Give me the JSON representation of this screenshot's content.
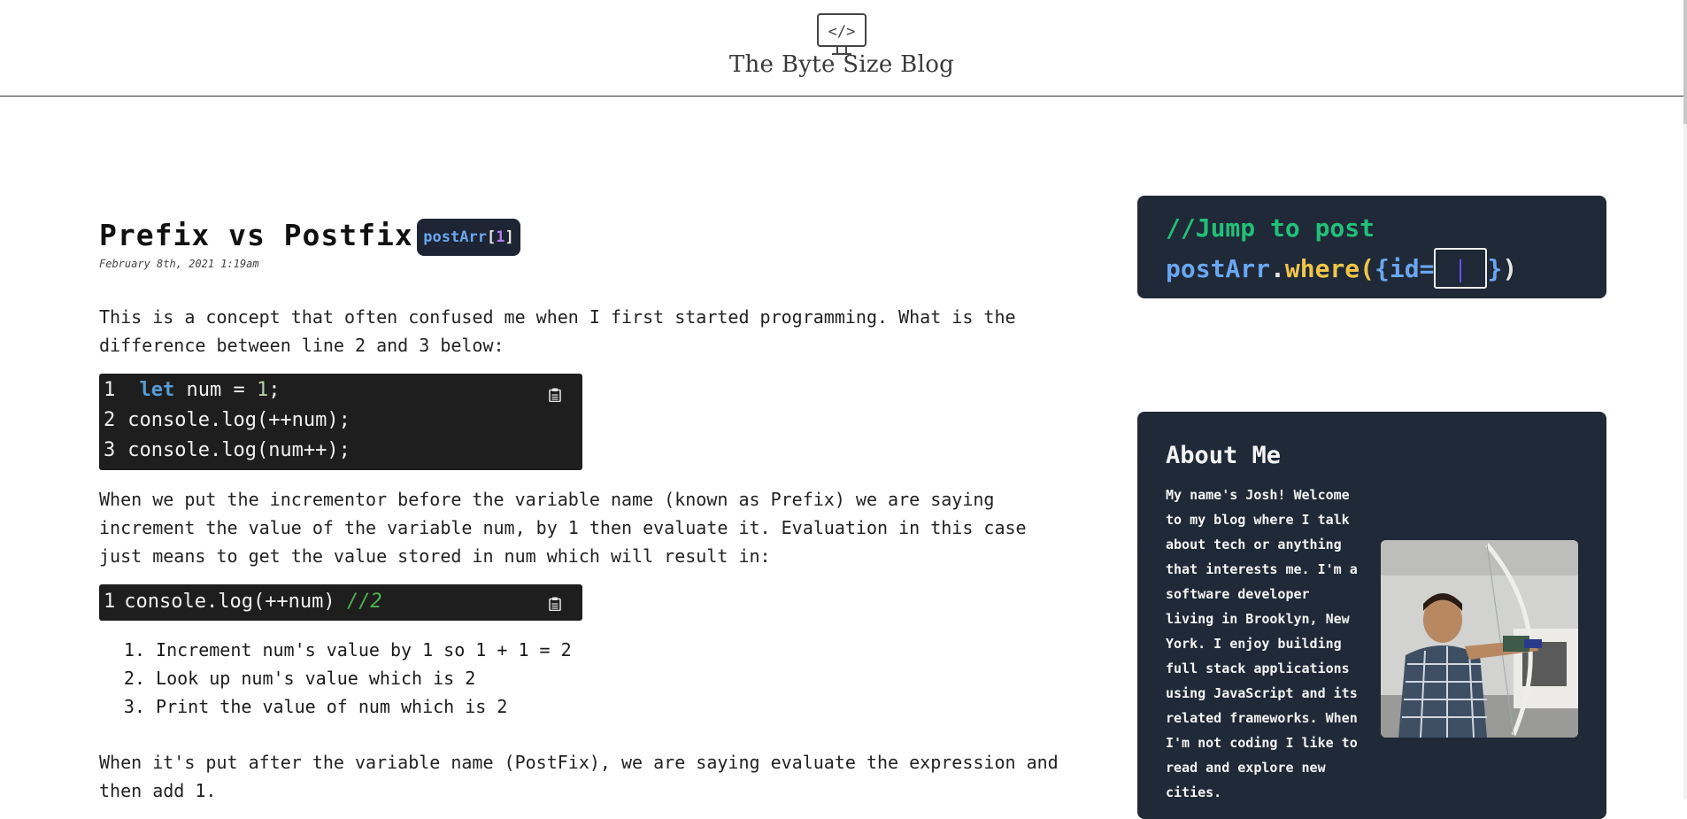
{
  "header": {
    "logo_glyph": "</>",
    "blog_title": "The Byte Size Blog"
  },
  "post": {
    "title": "Prefix vs Postfix",
    "badge": {
      "prefix": "postArr",
      "open": "[",
      "index": "1",
      "close": "]"
    },
    "date": "February 8th, 2021 1:19am",
    "intro": "This is a concept that often confused me when I first started programming. What is the difference between line 2 and 3 below:",
    "code_block_1": {
      "lines": [
        {
          "num": "1",
          "kw": "let",
          "mid": " num = ",
          "val": "1",
          "end": ";"
        },
        {
          "num": "2",
          "text": "console.log(++num);"
        },
        {
          "num": "3",
          "text": "console.log(num++);"
        }
      ]
    },
    "explanation": "When we put the incrementor before the variable name (known as Prefix) we are saying increment the value of the variable num, by 1 then evaluate it. Evaluation in this case just means to get the value stored in num which will result in:",
    "code_block_2": {
      "num": "1",
      "text": "console.log(++num) ",
      "comment": "//2"
    },
    "steps": [
      {
        "n": "1.",
        "text": "Increment num's value by 1 so 1 + 1 = 2"
      },
      {
        "n": "2.",
        "text": "Look up num's value which is 2"
      },
      {
        "n": "3.",
        "text": "Print the value of num which is 2"
      }
    ],
    "postfix_para": "When it's put after the variable name (PostFix), we are saying evaluate the expression and then add 1."
  },
  "sidebar": {
    "jump": {
      "comment": "//Jump to post",
      "obj": "postArr",
      "dot": ".",
      "method": "where",
      "open_paren": "(",
      "open_brace": "{",
      "key": "id=",
      "input_value": "",
      "close_brace": "}",
      "close_paren": ")"
    },
    "about": {
      "title": "About Me",
      "text": "My name's Josh! Welcome to my blog where I talk about tech or anything that interests me. I'm a software developer living in Brooklyn, New York. I enjoy building full stack applications using JavaScript and its related frameworks. When I'm not coding I like to read and explore new cities."
    }
  },
  "colors": {
    "dark_panel": "#1f2937",
    "code_bg": "#1e1e1e",
    "keyword_blue": "#6aa7f0",
    "comment_green": "#22c07a",
    "method_yellow": "#f0c64a",
    "index_purple": "#b27ef0"
  }
}
